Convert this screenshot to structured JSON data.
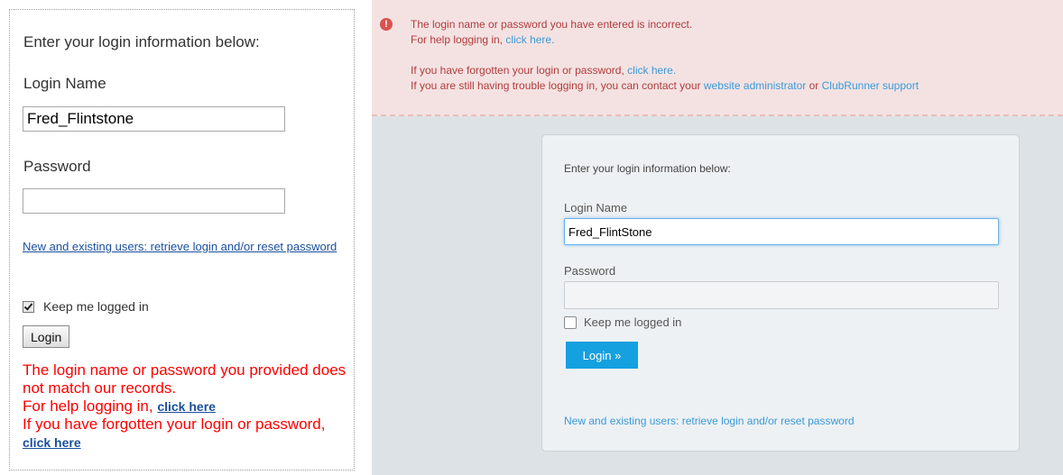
{
  "left_panel": {
    "intro": "Enter your login information below:",
    "login_label": "Login Name",
    "login_value": "Fred_Flintstone",
    "password_label": "Password",
    "new_users_link": "New and existing users: retrieve login and/or reset password",
    "keep_logged_in": "Keep me logged in",
    "keep_logged_in_checked": true,
    "login_button": "Login",
    "error": {
      "line1": "The login name or password you provided does not match our records.",
      "help_text": "For help logging in,",
      "help_link": "click here",
      "forgot_text": "If you have forgotten your login or password,",
      "forgot_link": "click here"
    }
  },
  "right_panel": {
    "alert": {
      "icon": "alert-circle-icon",
      "line1": "The login name or password you have entered is incorrect.",
      "help_text": "For help logging in,",
      "help_link": "click here.",
      "forgot_text": "If you have forgotten your login or password,",
      "forgot_link": "click here.",
      "trouble_text": "If you are still having trouble logging in, you can contact your",
      "admin_link": "website administrator",
      "or_text": "or",
      "support_link": "ClubRunner support"
    },
    "form": {
      "intro": "Enter your login information below:",
      "login_label": "Login Name",
      "login_value": "Fred_FlintStone",
      "password_label": "Password",
      "keep_logged_in": "Keep me logged in",
      "keep_logged_in_checked": false,
      "login_button": "Login »",
      "new_users_link": "New and existing users: retrieve login and/or reset password"
    },
    "colors": {
      "accent": "#15a0e0",
      "link": "#3a9ad9",
      "error_text": "#b23b3b",
      "alert_bg": "#f4e2e2"
    }
  }
}
